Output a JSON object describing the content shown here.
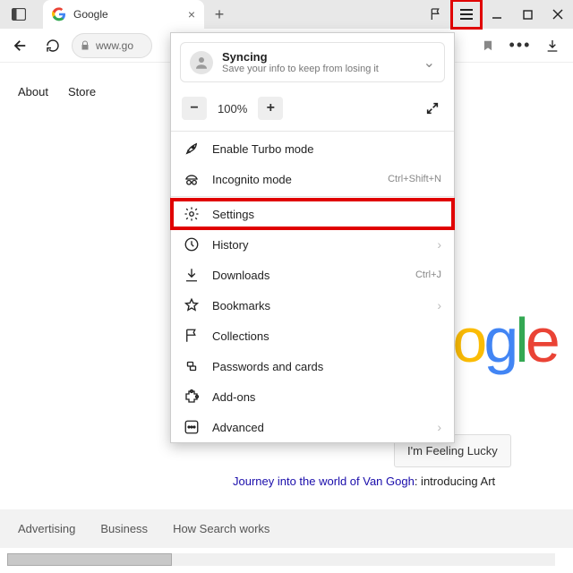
{
  "titlebar": {
    "tab_title": "Google",
    "favicon_letter": "G"
  },
  "toolbar": {
    "url": "www.go"
  },
  "menu": {
    "sync": {
      "title": "Syncing",
      "subtitle": "Save your info to keep from losing it"
    },
    "zoom": {
      "value": "100%"
    },
    "items": [
      {
        "label": "Enable Turbo mode",
        "hint": "",
        "sub": false
      },
      {
        "label": "Incognito mode",
        "hint": "Ctrl+Shift+N",
        "sub": false
      },
      {
        "label": "Settings",
        "hint": "",
        "sub": false
      },
      {
        "label": "History",
        "hint": "",
        "sub": true
      },
      {
        "label": "Downloads",
        "hint": "Ctrl+J",
        "sub": false
      },
      {
        "label": "Bookmarks",
        "hint": "",
        "sub": true
      },
      {
        "label": "Collections",
        "hint": "",
        "sub": false
      },
      {
        "label": "Passwords and cards",
        "hint": "",
        "sub": false
      },
      {
        "label": "Add-ons",
        "hint": "",
        "sub": false
      },
      {
        "label": "Advanced",
        "hint": "",
        "sub": true
      }
    ]
  },
  "page": {
    "nav": [
      "About",
      "Store"
    ],
    "logo": "Google",
    "lucky": "I'm Feeling Lucky",
    "promo_link": "Journey into the world of Van Gogh",
    "promo_tail": ": introducing Art",
    "footer": [
      "Advertising",
      "Business",
      "How Search works"
    ]
  }
}
